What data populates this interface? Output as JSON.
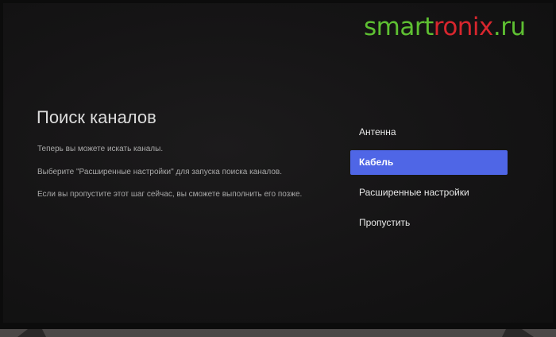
{
  "watermark": {
    "part1": "smart",
    "part2": "ronix",
    "part3": ".ru"
  },
  "colors": {
    "accent": "#4f66e6",
    "watermark_green": "#5ec032",
    "watermark_red": "#d8262e"
  },
  "screen": {
    "title": "Поиск каналов",
    "description": [
      "Теперь вы можете искать каналы.",
      "Выберите \"Расширенные настройки\" для запуска поиска каналов.",
      "Если вы пропустите этот шаг сейчас, вы сможете выполнить его позже."
    ]
  },
  "menu": {
    "items": [
      {
        "label": "Антенна",
        "selected": false
      },
      {
        "label": "Кабель",
        "selected": true
      },
      {
        "label": "Расширенные настройки",
        "selected": false
      },
      {
        "label": "Пропустить",
        "selected": false
      }
    ]
  }
}
